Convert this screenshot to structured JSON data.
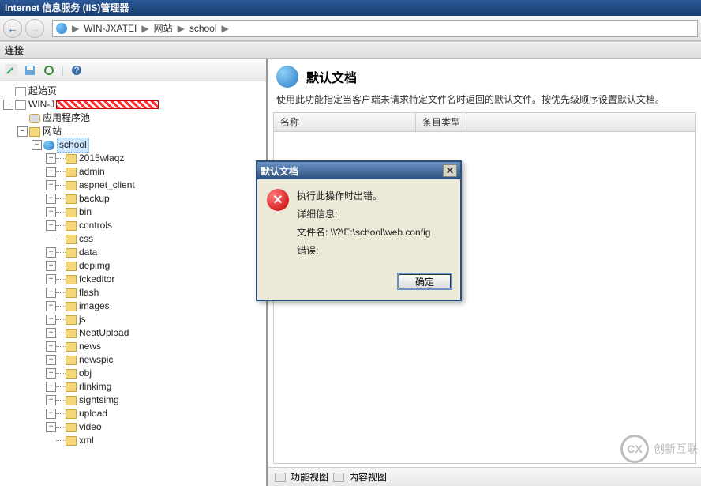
{
  "titlebar": "Internet 信息服务 (IIS)管理器",
  "breadcrumb": {
    "host": "WIN-JXATEI",
    "site": "网站",
    "app": "school"
  },
  "panel_label": "连接",
  "tree": {
    "start": "起始页",
    "host_label": "WIN-J",
    "apppool": "应用程序池",
    "sites": "网站",
    "app": "school",
    "folders": [
      "2015wlaqz",
      "admin",
      "aspnet_client",
      "backup",
      "bin",
      "controls",
      "css",
      "data",
      "depimg",
      "fckeditor",
      "flash",
      "images",
      "js",
      "NeatUpload",
      "news",
      "newspic",
      "obj",
      "rlinkimg",
      "sightsimg",
      "upload",
      "video",
      "xml"
    ]
  },
  "right": {
    "title": "默认文档",
    "desc": "使用此功能指定当客户端未请求特定文件名时返回的默认文件。按优先级顺序设置默认文档。",
    "col1": "名称",
    "col2": "条目类型",
    "view_a": "功能视图",
    "view_b": "内容视图"
  },
  "dialog": {
    "title": "默认文档",
    "line1": "执行此操作时出错。",
    "line2": "详细信息:",
    "line3": "文件名: \\\\?\\E:\\school\\web.config",
    "line4": "错误:",
    "ok": "确定"
  },
  "watermark": "创新互联"
}
